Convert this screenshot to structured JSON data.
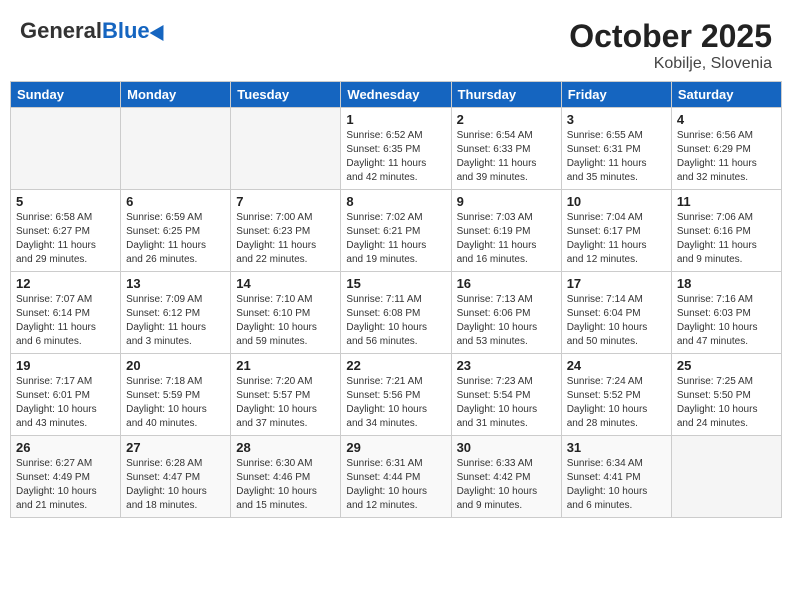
{
  "header": {
    "logo_general": "General",
    "logo_blue": "Blue",
    "month": "October 2025",
    "location": "Kobilje, Slovenia"
  },
  "days_of_week": [
    "Sunday",
    "Monday",
    "Tuesday",
    "Wednesday",
    "Thursday",
    "Friday",
    "Saturday"
  ],
  "weeks": [
    [
      {
        "day": "",
        "info": ""
      },
      {
        "day": "",
        "info": ""
      },
      {
        "day": "",
        "info": ""
      },
      {
        "day": "1",
        "info": "Sunrise: 6:52 AM\nSunset: 6:35 PM\nDaylight: 11 hours\nand 42 minutes."
      },
      {
        "day": "2",
        "info": "Sunrise: 6:54 AM\nSunset: 6:33 PM\nDaylight: 11 hours\nand 39 minutes."
      },
      {
        "day": "3",
        "info": "Sunrise: 6:55 AM\nSunset: 6:31 PM\nDaylight: 11 hours\nand 35 minutes."
      },
      {
        "day": "4",
        "info": "Sunrise: 6:56 AM\nSunset: 6:29 PM\nDaylight: 11 hours\nand 32 minutes."
      }
    ],
    [
      {
        "day": "5",
        "info": "Sunrise: 6:58 AM\nSunset: 6:27 PM\nDaylight: 11 hours\nand 29 minutes."
      },
      {
        "day": "6",
        "info": "Sunrise: 6:59 AM\nSunset: 6:25 PM\nDaylight: 11 hours\nand 26 minutes."
      },
      {
        "day": "7",
        "info": "Sunrise: 7:00 AM\nSunset: 6:23 PM\nDaylight: 11 hours\nand 22 minutes."
      },
      {
        "day": "8",
        "info": "Sunrise: 7:02 AM\nSunset: 6:21 PM\nDaylight: 11 hours\nand 19 minutes."
      },
      {
        "day": "9",
        "info": "Sunrise: 7:03 AM\nSunset: 6:19 PM\nDaylight: 11 hours\nand 16 minutes."
      },
      {
        "day": "10",
        "info": "Sunrise: 7:04 AM\nSunset: 6:17 PM\nDaylight: 11 hours\nand 12 minutes."
      },
      {
        "day": "11",
        "info": "Sunrise: 7:06 AM\nSunset: 6:16 PM\nDaylight: 11 hours\nand 9 minutes."
      }
    ],
    [
      {
        "day": "12",
        "info": "Sunrise: 7:07 AM\nSunset: 6:14 PM\nDaylight: 11 hours\nand 6 minutes."
      },
      {
        "day": "13",
        "info": "Sunrise: 7:09 AM\nSunset: 6:12 PM\nDaylight: 11 hours\nand 3 minutes."
      },
      {
        "day": "14",
        "info": "Sunrise: 7:10 AM\nSunset: 6:10 PM\nDaylight: 10 hours\nand 59 minutes."
      },
      {
        "day": "15",
        "info": "Sunrise: 7:11 AM\nSunset: 6:08 PM\nDaylight: 10 hours\nand 56 minutes."
      },
      {
        "day": "16",
        "info": "Sunrise: 7:13 AM\nSunset: 6:06 PM\nDaylight: 10 hours\nand 53 minutes."
      },
      {
        "day": "17",
        "info": "Sunrise: 7:14 AM\nSunset: 6:04 PM\nDaylight: 10 hours\nand 50 minutes."
      },
      {
        "day": "18",
        "info": "Sunrise: 7:16 AM\nSunset: 6:03 PM\nDaylight: 10 hours\nand 47 minutes."
      }
    ],
    [
      {
        "day": "19",
        "info": "Sunrise: 7:17 AM\nSunset: 6:01 PM\nDaylight: 10 hours\nand 43 minutes."
      },
      {
        "day": "20",
        "info": "Sunrise: 7:18 AM\nSunset: 5:59 PM\nDaylight: 10 hours\nand 40 minutes."
      },
      {
        "day": "21",
        "info": "Sunrise: 7:20 AM\nSunset: 5:57 PM\nDaylight: 10 hours\nand 37 minutes."
      },
      {
        "day": "22",
        "info": "Sunrise: 7:21 AM\nSunset: 5:56 PM\nDaylight: 10 hours\nand 34 minutes."
      },
      {
        "day": "23",
        "info": "Sunrise: 7:23 AM\nSunset: 5:54 PM\nDaylight: 10 hours\nand 31 minutes."
      },
      {
        "day": "24",
        "info": "Sunrise: 7:24 AM\nSunset: 5:52 PM\nDaylight: 10 hours\nand 28 minutes."
      },
      {
        "day": "25",
        "info": "Sunrise: 7:25 AM\nSunset: 5:50 PM\nDaylight: 10 hours\nand 24 minutes."
      }
    ],
    [
      {
        "day": "26",
        "info": "Sunrise: 6:27 AM\nSunset: 4:49 PM\nDaylight: 10 hours\nand 21 minutes."
      },
      {
        "day": "27",
        "info": "Sunrise: 6:28 AM\nSunset: 4:47 PM\nDaylight: 10 hours\nand 18 minutes."
      },
      {
        "day": "28",
        "info": "Sunrise: 6:30 AM\nSunset: 4:46 PM\nDaylight: 10 hours\nand 15 minutes."
      },
      {
        "day": "29",
        "info": "Sunrise: 6:31 AM\nSunset: 4:44 PM\nDaylight: 10 hours\nand 12 minutes."
      },
      {
        "day": "30",
        "info": "Sunrise: 6:33 AM\nSunset: 4:42 PM\nDaylight: 10 hours\nand 9 minutes."
      },
      {
        "day": "31",
        "info": "Sunrise: 6:34 AM\nSunset: 4:41 PM\nDaylight: 10 hours\nand 6 minutes."
      },
      {
        "day": "",
        "info": ""
      }
    ]
  ]
}
